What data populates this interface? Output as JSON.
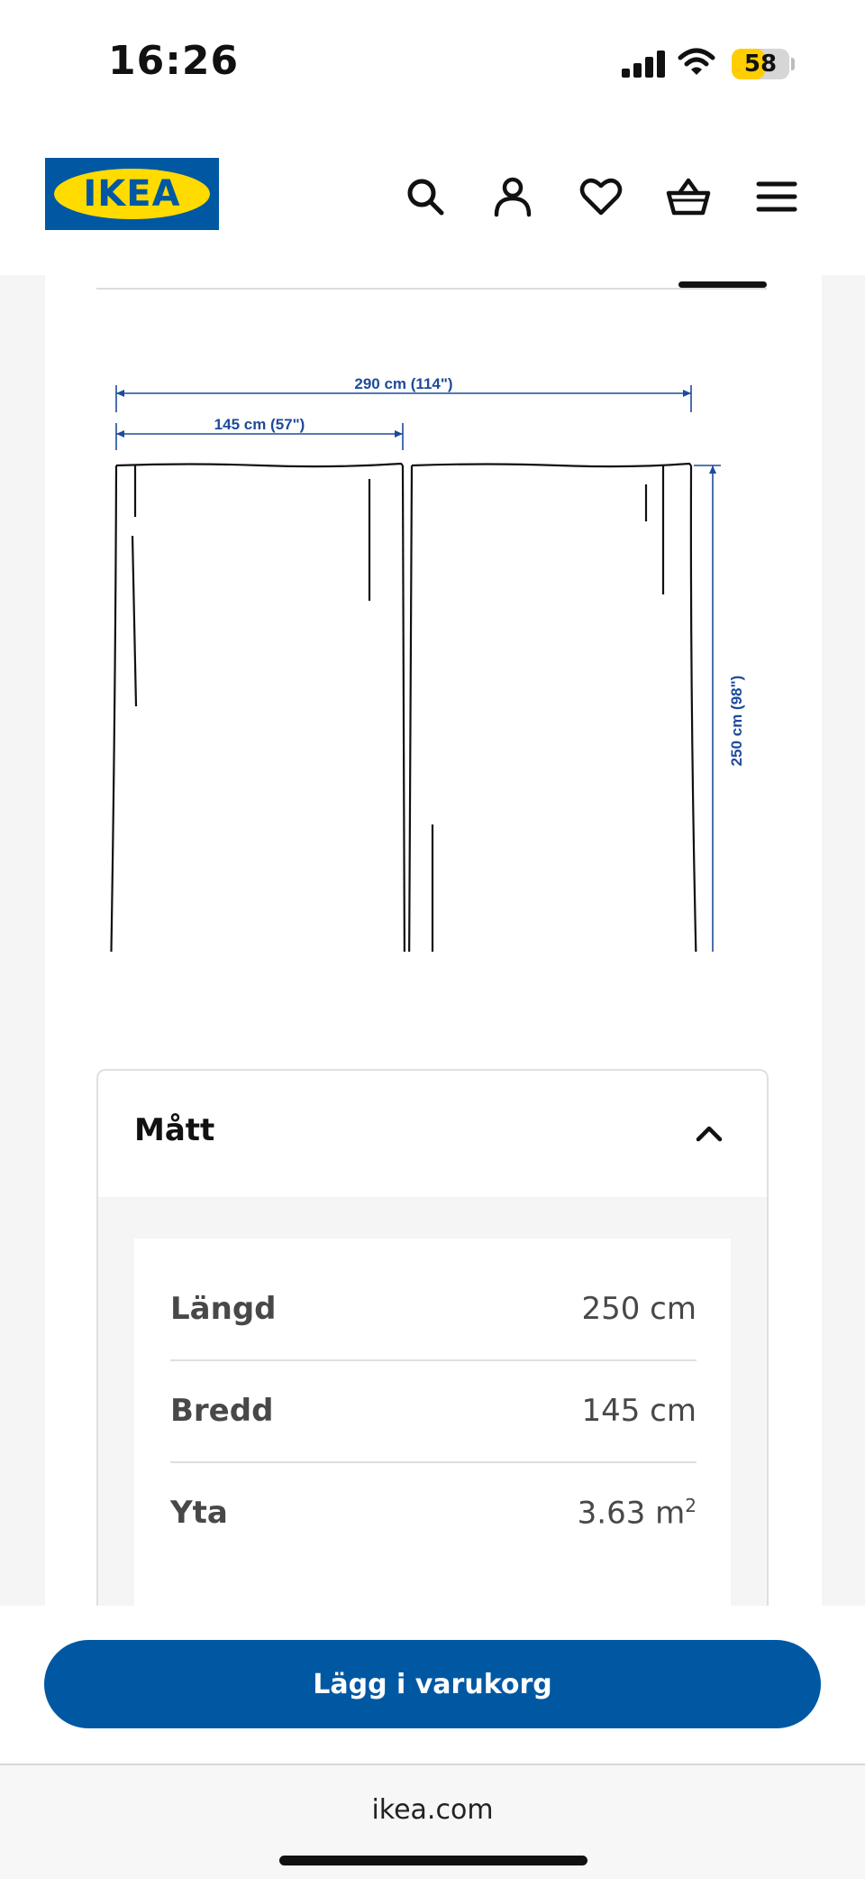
{
  "status_bar": {
    "time": "16:26",
    "battery_percent": "58",
    "battery_level": 0.58,
    "icons": [
      "cellular-signal-icon",
      "wifi-icon",
      "battery-icon"
    ]
  },
  "header": {
    "logo_text": "IKEA",
    "icons": [
      "search-icon",
      "account-icon",
      "favorites-heart-icon",
      "shopping-basket-icon",
      "menu-hamburger-icon"
    ]
  },
  "drawing": {
    "total_width_label": "290 cm (114\")",
    "panel_width_label": "145 cm (57\")",
    "height_label": "250 cm (98\")"
  },
  "dimensions_accordion": {
    "title": "Mått",
    "expanded": true,
    "rows": [
      {
        "label": "Längd",
        "value": "250 cm"
      },
      {
        "label": "Bredd",
        "value": "145 cm"
      },
      {
        "label": "Yta",
        "value_number": "3.63 m",
        "value_sup": "2"
      }
    ]
  },
  "cart": {
    "button_label": "Lägg i varukorg"
  },
  "browser": {
    "url": "ikea.com"
  },
  "colors": {
    "brand_blue": "#0058a3",
    "brand_yellow": "#ffdb00",
    "dimension_blue": "#1e4b9a"
  }
}
